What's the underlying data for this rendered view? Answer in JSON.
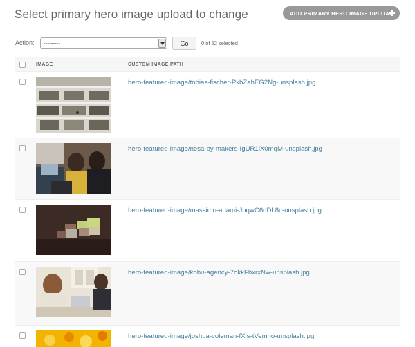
{
  "header": {
    "title": "Select primary hero image upload to change",
    "add_button_label": "ADD PRIMARY HERO IMAGE UPLOAD"
  },
  "actions": {
    "label": "Action:",
    "selected_option": "---------",
    "go_label": "Go",
    "selection_count": "0 of 52 selected"
  },
  "table": {
    "columns": [
      "IMAGE",
      "CUSTOM IMAGE PATH"
    ],
    "rows": [
      {
        "path": "hero-featured-image/tobias-fischer-PkbZahEG2Ng-unsplash.jpg",
        "image": "library-shelves-photo"
      },
      {
        "path": "hero-featured-image/nesa-by-makers-IgUR1iX0mqM-unsplash.jpg",
        "image": "people-at-laptop-photo"
      },
      {
        "path": "hero-featured-image/massimo-adami-JnqwC6dDL8c-unsplash.jpg",
        "image": "stacked-blocks-photo"
      },
      {
        "path": "hero-featured-image/kobu-agency-7okkFhxrxNw-unsplash.jpg",
        "image": "office-meeting-photo"
      },
      {
        "path": "hero-featured-image/joshua-coleman-fXls-tVemno-unsplash.jpg",
        "image": "yellow-abstract-photo"
      }
    ]
  },
  "colors": {
    "link": "#447e9b",
    "add_button_bg": "#999999",
    "header_bg": "#f6f6f6"
  }
}
